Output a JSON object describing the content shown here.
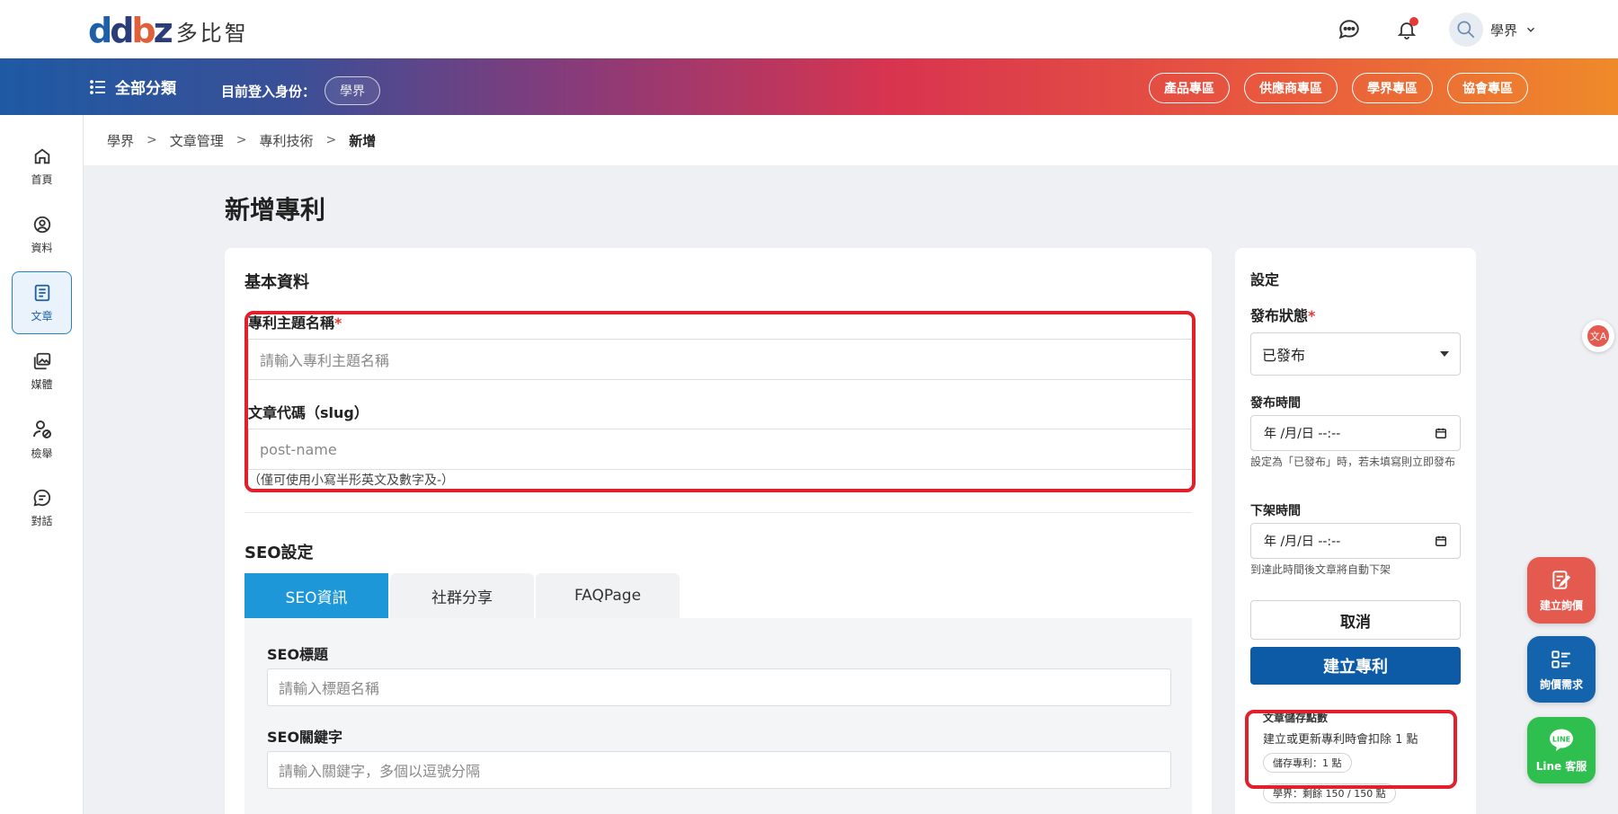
{
  "brand": {
    "name": "多比智"
  },
  "header": {
    "user_name": "學界"
  },
  "nav": {
    "all_categories": "全部分類",
    "identity_label": "目前登入身份：",
    "identity_value": "學界",
    "zones": [
      "產品專區",
      "供應商專區",
      "學界專區",
      "協會專區"
    ]
  },
  "sidebar": {
    "items": [
      {
        "label": "首頁",
        "icon": "home-icon"
      },
      {
        "label": "資料",
        "icon": "user-circle-icon"
      },
      {
        "label": "文章",
        "icon": "article-icon",
        "active": true
      },
      {
        "label": "媒體",
        "icon": "media-icon"
      },
      {
        "label": "檢舉",
        "icon": "report-user-icon"
      },
      {
        "label": "對話",
        "icon": "chat-icon"
      }
    ]
  },
  "breadcrumb": [
    "學界",
    "文章管理",
    "專利技術",
    "新增"
  ],
  "page": {
    "title": "新增專利"
  },
  "form": {
    "basic_title": "基本資料",
    "topic_label": "專利主題名稱",
    "required_mark": "*",
    "topic_placeholder": "請輸入專利主題名稱",
    "slug_label": "文章代碼（slug）",
    "slug_placeholder": "post-name",
    "slug_hint": "（僅可使用小寫半形英文及數字及-）",
    "seo_title": "SEO設定",
    "tabs": [
      "SEO資訊",
      "社群分享",
      "FAQPage"
    ],
    "seo_title_label": "SEO標題",
    "seo_title_placeholder": "請輸入標題名稱",
    "seo_keywords_label": "SEO關鍵字",
    "seo_keywords_placeholder": "請輸入關鍵字，多個以逗號分隔"
  },
  "settings": {
    "title": "設定",
    "status_label": "發布狀態",
    "status_value": "已發布",
    "publish_time_label": "發布時間",
    "date_placeholder": "年 /月/日 --:--",
    "publish_hint": "設定為「已發布」時，若未填寫則立即發布",
    "unpublish_time_label": "下架時間",
    "unpublish_hint": "到達此時間後文章將自動下架",
    "cancel_label": "取消",
    "create_label": "建立專利",
    "points_title": "文章儲存點數",
    "points_desc": "建立或更新專利時會扣除 1 點",
    "points_chip": "儲存專利：1 點",
    "points_remaining": "學界：剩餘 150 / 150 點"
  },
  "fabs": [
    {
      "label": "建立詢價",
      "color": "#e55a4f"
    },
    {
      "label": "詢價需求",
      "color": "#1464ad"
    },
    {
      "label": "Line 客服",
      "color": "#2fbf4f"
    }
  ]
}
